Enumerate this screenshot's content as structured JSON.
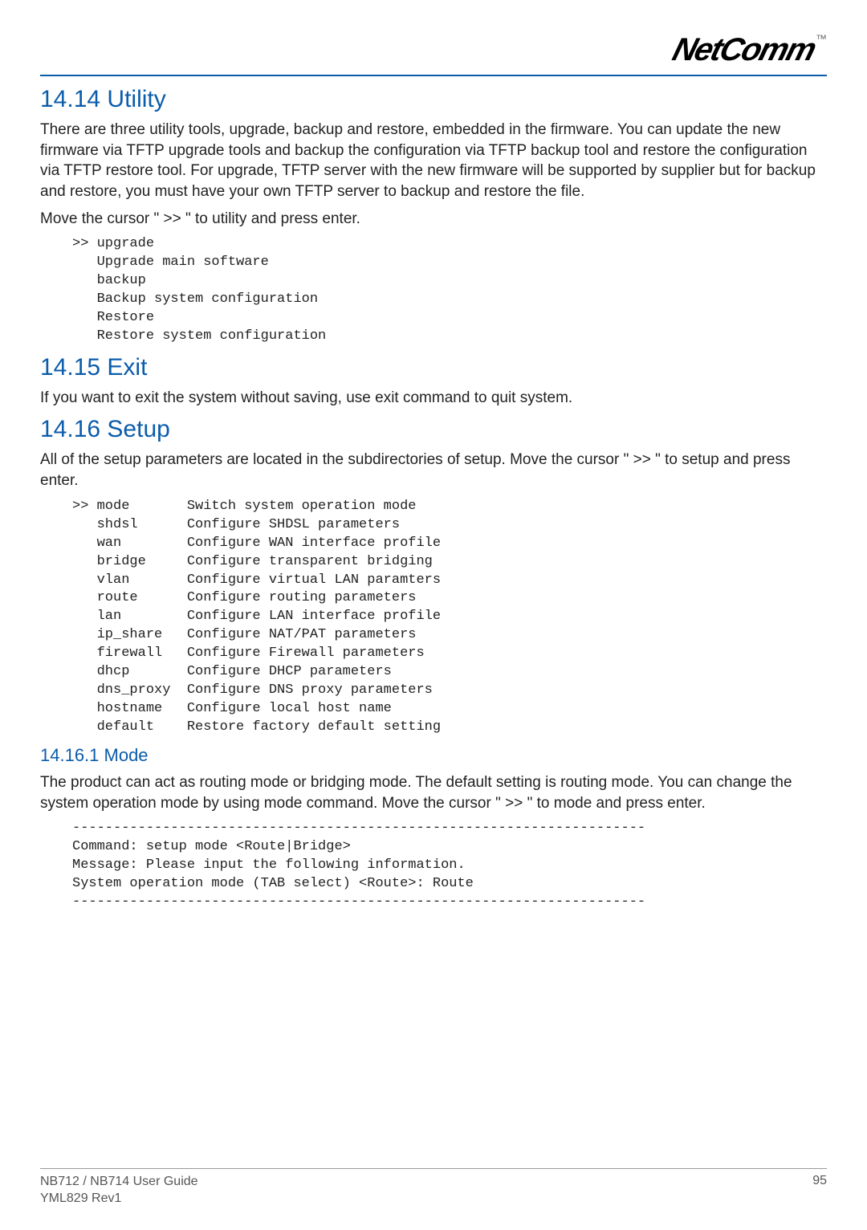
{
  "logo": {
    "text": "NetComm",
    "tm": "™"
  },
  "sections": {
    "utility": {
      "heading": "14.14 Utility",
      "para1": "There are three utility tools, upgrade, backup and restore, embedded in the firmware. You can update the new firmware via TFTP upgrade tools and backup the configuration via TFTP backup tool and restore the configuration via TFTP restore tool. For upgrade, TFTP server with the new firmware will be supported by supplier but for backup and restore, you must have your own TFTP server to backup and restore the file.",
      "para2": "Move the cursor \" >> \" to utility and press enter.",
      "code": ">> upgrade\n   Upgrade main software\n   backup\n   Backup system configuration\n   Restore\n   Restore system configuration"
    },
    "exit": {
      "heading": "14.15 Exit",
      "para1": "If you want to exit the system without saving, use exit command to quit system."
    },
    "setup": {
      "heading": "14.16 Setup",
      "para1": "All of the setup parameters are located in the subdirectories of setup. Move the cursor \" >> \" to setup and press enter.",
      "code": ">> mode       Switch system operation mode\n   shdsl      Configure SHDSL parameters\n   wan        Configure WAN interface profile\n   bridge     Configure transparent bridging\n   vlan       Configure virtual LAN paramters\n   route      Configure routing parameters\n   lan        Configure LAN interface profile\n   ip_share   Configure NAT/PAT parameters\n   firewall   Configure Firewall parameters\n   dhcp       Configure DHCP parameters\n   dns_proxy  Configure DNS proxy parameters\n   hostname   Configure local host name\n   default    Restore factory default setting"
    },
    "mode": {
      "heading": "14.16.1 Mode",
      "para1": "The product can act as routing mode or bridging mode. The default setting is routing mode. You can change the system operation mode by using mode command. Move the cursor \" >> \" to mode and press enter.",
      "code": "----------------------------------------------------------------------\nCommand: setup mode <Route|Bridge>\nMessage: Please input the following information.\nSystem operation mode (TAB select) <Route>: Route\n----------------------------------------------------------------------"
    }
  },
  "footer": {
    "left1": "NB712 / NB714 User Guide",
    "left2": "YML829 Rev1",
    "right": "95"
  }
}
